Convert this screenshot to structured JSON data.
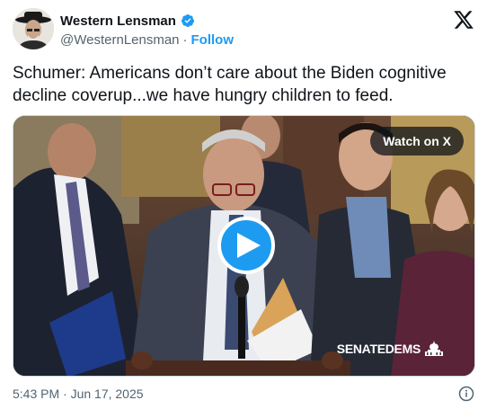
{
  "author": {
    "display_name": "Western Lensman",
    "handle": "@WesternLensman",
    "separator": "·",
    "follow_label": "Follow"
  },
  "tweet": {
    "text": "Schumer: Americans don’t care about the Biden cognitive decline coverup...we have hungry children to feed."
  },
  "media": {
    "watch_label": "Watch on X",
    "watermark": "SENATEDEMS"
  },
  "footer": {
    "timestamp": "5:43 PM · Jun 17, 2025"
  },
  "colors": {
    "accent": "#1d9bf0",
    "text": "#0f1419",
    "secondary": "#536471"
  }
}
